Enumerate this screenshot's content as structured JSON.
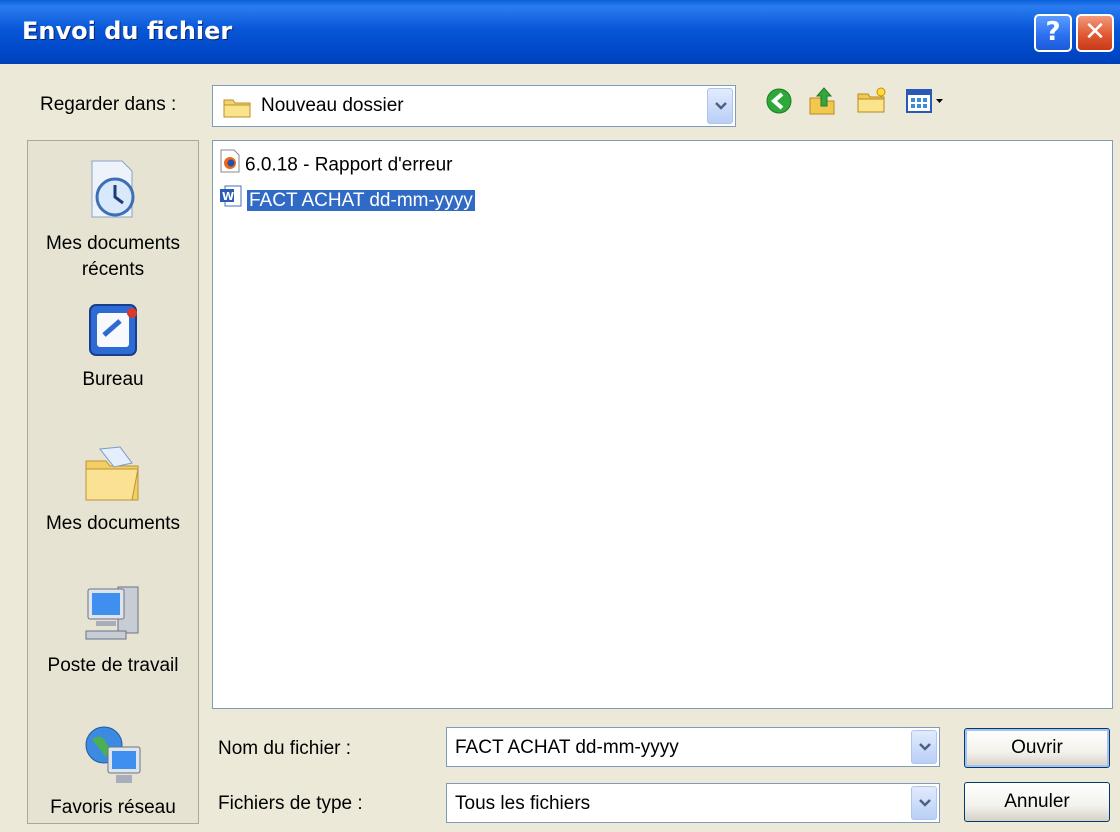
{
  "window": {
    "title": "Envoi du fichier",
    "help_glyph": "?",
    "close_glyph": "✕"
  },
  "lookin": {
    "label": "Regarder dans :",
    "value": "Nouveau dossier"
  },
  "toolbar": {
    "icons": [
      "back-icon",
      "up-folder-icon",
      "new-folder-icon",
      "view-menu-icon"
    ]
  },
  "places": [
    {
      "label": "Mes documents récents",
      "icon": "recent-documents-icon"
    },
    {
      "label": "Bureau",
      "icon": "desktop-icon"
    },
    {
      "label": "Mes documents",
      "icon": "my-documents-icon"
    },
    {
      "label": "Poste de travail",
      "icon": "my-computer-icon"
    },
    {
      "label": "Favoris réseau",
      "icon": "network-places-icon"
    }
  ],
  "files": [
    {
      "name": "6.0.18 - Rapport d'erreur",
      "icon": "firefox-icon",
      "selected": false
    },
    {
      "name": "FACT ACHAT dd-mm-yyyy",
      "icon": "word-doc-icon",
      "selected": true
    }
  ],
  "filename": {
    "label": "Nom du fichier :",
    "value": "FACT ACHAT dd-mm-yyyy"
  },
  "filetype": {
    "label": "Fichiers de type :",
    "value": "Tous les fichiers"
  },
  "buttons": {
    "open": "Ouvrir",
    "cancel": "Annuler"
  },
  "colors": {
    "titlebar": "#0054e3",
    "selection": "#316ac5",
    "background": "#ece9d8"
  }
}
